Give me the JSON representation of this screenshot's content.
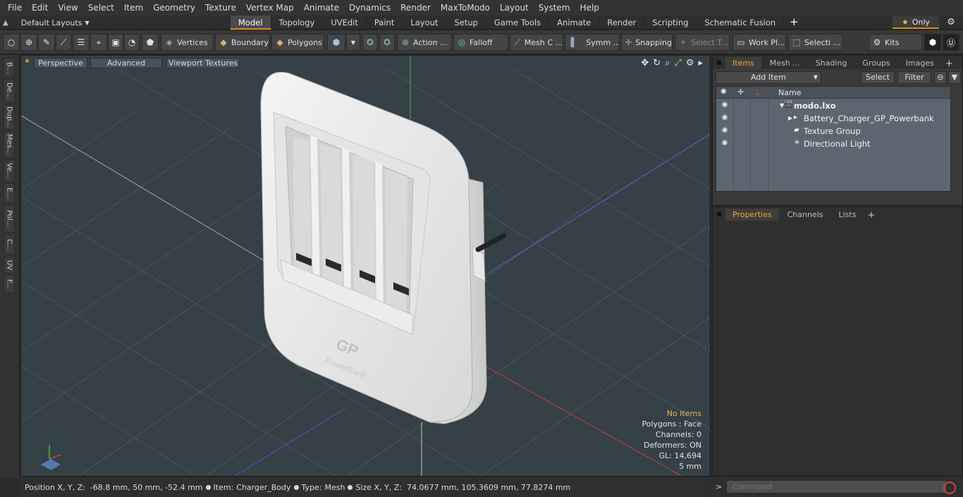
{
  "menu": [
    "File",
    "Edit",
    "View",
    "Select",
    "Item",
    "Geometry",
    "Texture",
    "Vertex Map",
    "Animate",
    "Dynamics",
    "Render",
    "MaxToModo",
    "Layout",
    "System",
    "Help"
  ],
  "layout_selector": "Default Layouts",
  "tabs": [
    "Model",
    "Topology",
    "UVEdit",
    "Paint",
    "Layout",
    "Setup",
    "Game Tools",
    "Animate",
    "Render",
    "Scripting",
    "Schematic Fusion"
  ],
  "active_tab": "Model",
  "only_label": "Only",
  "toolbar": {
    "vertices": "Vertices",
    "boundary": "Boundary",
    "polygons": "Polygons",
    "action": "Action ...",
    "falloff": "Falloff",
    "mesh": "Mesh C ...",
    "symm": "Symm ...",
    "snapping": "Snapping",
    "select_t": "Select T...",
    "work_pl": "Work Pl...",
    "selecti": "Selecti ...",
    "kits": "Kits"
  },
  "left_tabs": [
    "B...",
    "De...",
    "Dup...",
    "Mes...",
    "Ve...",
    "E...",
    "Pol...",
    "C...",
    "UV",
    "F..."
  ],
  "viewport": {
    "perspective": "Perspective",
    "advanced": "Advanced",
    "textures": "Viewport Textures",
    "info": {
      "items": "No Items",
      "polygons": "Polygons : Face",
      "channels": "Channels: 0",
      "deformers": "Deformers: ON",
      "gl": "GL: 14,694",
      "scale": "5 mm"
    },
    "product_logo": "GP",
    "product_sub": "PowerBank"
  },
  "items_panel": {
    "tabs": [
      "Items",
      "Mesh ...",
      "Shading",
      "Groups",
      "Images"
    ],
    "active": "Items",
    "add_item": "Add Item",
    "select": "Select",
    "filter": "Filter",
    "name_col": "Name",
    "tree": [
      {
        "label": "modo.lxo",
        "bold": true
      },
      {
        "label": "Battery_Charger_GP_Powerbank"
      },
      {
        "label": "Texture Group"
      },
      {
        "label": "Directional Light"
      }
    ]
  },
  "props_panel": {
    "tabs": [
      "Properties",
      "Channels",
      "Lists"
    ],
    "active": "Properties"
  },
  "status": {
    "position_label": "Position X, Y, Z:",
    "position": "-68.8 mm, 50 mm, -52.4 mm",
    "item_label": "Item:",
    "item": "Charger_Body",
    "type_label": "Type:",
    "type": "Mesh",
    "size_label": "Size X, Y, Z:",
    "size": "74.0677 mm, 105.3609 mm, 77.8274 mm"
  },
  "command_placeholder": "Command",
  "colors": {
    "accent": "#e08a1a",
    "viewport_bg": "#364047",
    "info_highlight": "#e9b64a"
  }
}
